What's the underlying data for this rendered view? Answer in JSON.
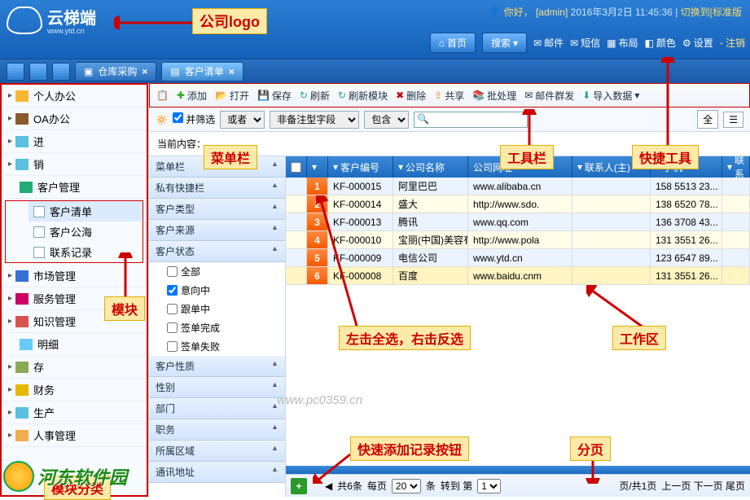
{
  "header": {
    "brand": "云梯端",
    "brand_url": "www.ytd.cn",
    "greeting": "你好，",
    "user": "[admin]",
    "datetime": "2016年3月2日 11:45:36",
    "switch": "切换到[标准版",
    "home": "首页",
    "search": "搜索",
    "mail": "邮件",
    "sms": "短信",
    "layout": "布局",
    "color": "颜色",
    "settings": "设置",
    "logout": "注销"
  },
  "tabs": [
    {
      "label": "仓库采购"
    },
    {
      "label": "客户清单"
    }
  ],
  "leftnav": {
    "items": [
      "个人办公",
      "OA办公",
      "进",
      "销"
    ],
    "cust_mgmt": "客户管理",
    "cust_sub": [
      "客户清单",
      "客户公海",
      "联系记录"
    ],
    "rest": [
      "市场管理",
      "服务管理",
      "知识管理",
      "明细",
      "存",
      "财务",
      "生产",
      "人事管理"
    ]
  },
  "toolbar": {
    "add": "添加",
    "open": "打开",
    "save": "保存",
    "refresh": "刷新",
    "refreshmod": "刷新模块",
    "delete": "删除",
    "share": "共享",
    "batch": "批处理",
    "mailg": "邮件群发",
    "import": "导入数据"
  },
  "filter": {
    "combine": "并筛选",
    "or": "或者",
    "field": "非备注型字段",
    "contain": "包含",
    "all": "全"
  },
  "current_label": "当前内容：",
  "catcol": {
    "menubar": "菜单栏",
    "private": "私有快捷栏",
    "ctype": "客户类型",
    "csrc": "客户来源",
    "cstatus": "客户状态",
    "status_items": [
      "全部",
      "意向中",
      "跟单中",
      "签单完成",
      "签单失败"
    ],
    "cattr": "客户性质",
    "gender": "性别",
    "dept": "部门",
    "job": "职务",
    "region": "所属区域",
    "addr": "通讯地址"
  },
  "grid": {
    "cols": [
      "",
      "",
      "客户编号",
      "公司名称",
      "公司网址",
      "联系人(主)",
      "手机",
      "联系"
    ],
    "rows": [
      {
        "n": "1",
        "id": "KF-000015",
        "name": "阿里巴巴",
        "url": "www.alibaba.cn",
        "tel": "158 5513 23..."
      },
      {
        "n": "2",
        "id": "KF-000014",
        "name": "盛大",
        "url": "http://www.sdo.",
        "tel": "138 6520 78..."
      },
      {
        "n": "3",
        "id": "KF-000013",
        "name": "腾讯",
        "url": "www.qq.com",
        "tel": "136 3708 43..."
      },
      {
        "n": "4",
        "id": "KF-000010",
        "name": "宝丽(中国)美容有限",
        "url": "http://www.pola",
        "tel": "131 3551 26..."
      },
      {
        "n": "5",
        "id": "KF-000009",
        "name": "电信公司",
        "url": "www.ytd.cn",
        "tel": "123 6547 89..."
      },
      {
        "n": "6",
        "id": "KF-000008",
        "name": "百度",
        "url": "www.baidu.cnm",
        "tel": "131 3551 26..."
      }
    ]
  },
  "pager": {
    "total": "共6条",
    "perpage": "每页",
    "pp_val": "20",
    "pp_unit": "条",
    "goto": "转到 第",
    "goto_val": "1",
    "pageinfo": "页/共1页",
    "nav": "上一页 下一页 尾页"
  },
  "ann": {
    "logo": "公司logo",
    "menubar": "菜单栏",
    "toolbar": "工具栏",
    "quick": "快捷工具",
    "module": "模块",
    "workarea": "工作区",
    "selhint": "左击全选，右击反选",
    "quickadd": "快速添加记录按钮",
    "paging": "分页",
    "modcat": "模块分类"
  },
  "watermark": {
    "text": "河东软件园",
    "url": "www.pc0359.cn"
  }
}
